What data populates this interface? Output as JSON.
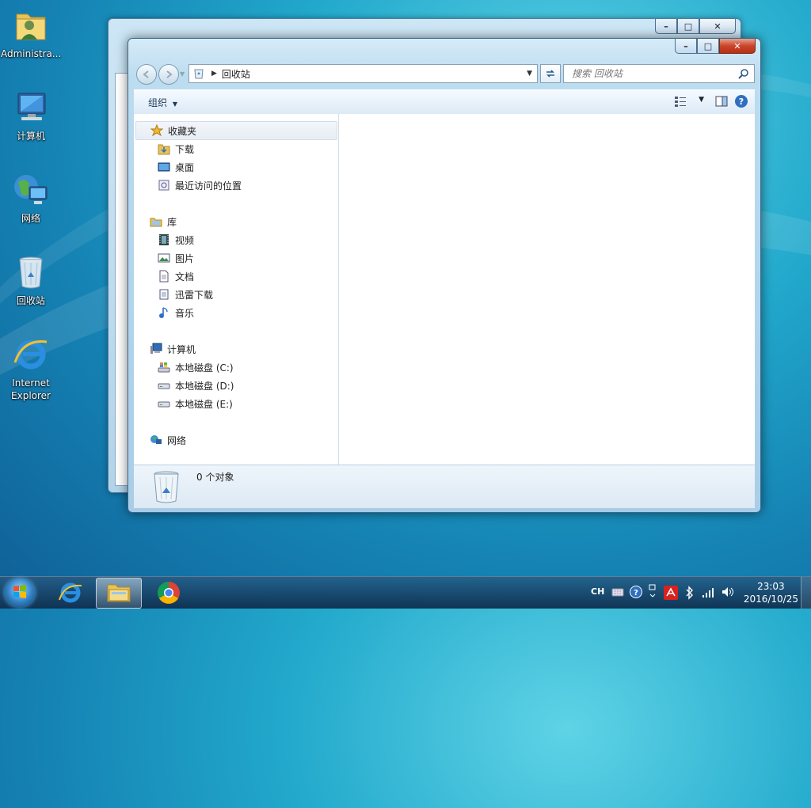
{
  "desktop": {
    "icons": [
      {
        "label": "Administra..."
      },
      {
        "label": "计算机"
      },
      {
        "label": "网络"
      },
      {
        "label": "回收站"
      },
      {
        "label": "Internet Explorer"
      }
    ]
  },
  "window": {
    "address_path": "回收站",
    "search_placeholder": "搜索 回收站",
    "toolbar": {
      "organize_label": "组织"
    },
    "nav": {
      "favorites": {
        "label": "收藏夹",
        "items": [
          {
            "label": "下载"
          },
          {
            "label": "桌面"
          },
          {
            "label": "最近访问的位置"
          }
        ]
      },
      "libraries": {
        "label": "库",
        "items": [
          {
            "label": "视频"
          },
          {
            "label": "图片"
          },
          {
            "label": "文档"
          },
          {
            "label": "迅雷下载"
          },
          {
            "label": "音乐"
          }
        ]
      },
      "computer": {
        "label": "计算机",
        "items": [
          {
            "label": "本地磁盘 (C:)"
          },
          {
            "label": "本地磁盘 (D:)"
          },
          {
            "label": "本地磁盘 (E:)"
          }
        ]
      },
      "network": {
        "label": "网络"
      }
    },
    "status": {
      "count": "0 个对象"
    }
  },
  "taskbar": {
    "tray": {
      "language": "CH"
    },
    "clock": {
      "time": "23:03",
      "date": "2016/10/25"
    }
  }
}
